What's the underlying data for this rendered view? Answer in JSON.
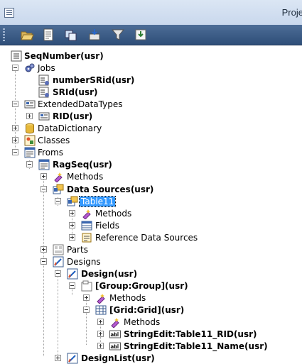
{
  "window": {
    "title": "Proje"
  },
  "toolbar": {
    "buttons": [
      {
        "icon": "open-folder-icon"
      },
      {
        "icon": "properties-icon"
      },
      {
        "icon": "duplicate-icon"
      },
      {
        "icon": "compile-icon"
      },
      {
        "icon": "filter-icon"
      },
      {
        "icon": "import-icon"
      }
    ]
  },
  "tree": {
    "root": "SeqNumber(usr)",
    "jobs": "Jobs",
    "job_1": "numberSRid(usr)",
    "job_2": "SRId(usr)",
    "edt": "ExtendedDataTypes",
    "edt_1": "RID(usr)",
    "datadictionary": "DataDictionary",
    "classes": "Classes",
    "forms": "Froms",
    "form_1": "RagSeq(usr)",
    "form_methods": "Methods",
    "datasources": "Data Sources(usr)",
    "table": "Table11",
    "table_methods": "Methods",
    "table_fields": "Fields",
    "table_refds": "Reference Data Sources",
    "parts": "Parts",
    "designs": "Designs",
    "design": "Design(usr)",
    "group": "[Group:Group](usr)",
    "group_methods": "Methods",
    "grid": "[Grid:Grid](usr)",
    "grid_methods": "Methods",
    "se_rid": "StringEdit:Table11_RID(usr)",
    "se_name": "StringEdit:Table11_Name(usr)",
    "designlist": "DesignList(usr)"
  }
}
